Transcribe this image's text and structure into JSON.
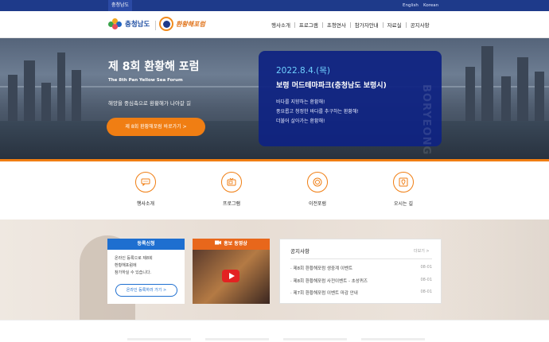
{
  "topbar": {
    "region": "충청남도",
    "lang_en": "English",
    "lang_ko": "Korean"
  },
  "header": {
    "logo1": "충청남도",
    "logo2": "환황해포럼",
    "nav": [
      "행사소개",
      "프로그램",
      "초청연사",
      "참가자안내",
      "자료실",
      "공지사항"
    ]
  },
  "hero": {
    "title": "제 8회 환황해 포럼",
    "subtitle": "The 8th Pan Yellow Sea Forum",
    "tagline": "해양을 중심축으로 환황해가 나아갈 길",
    "cta": "제 8회 환황해포럼 바로가기",
    "panel": {
      "date": "2022.8.4.(목)",
      "place": "보령 머드테마파크(충청남도 보령시)",
      "lines": [
        "바다를 지향하는 환황해!",
        "풍요롭고 청정한 바다를 추구하는 환황해!",
        "더불어 살아가는 환황해!"
      ],
      "vertical": "BORYEONG"
    }
  },
  "icon_menu": [
    {
      "label": "행사소개",
      "icon": "chat-icon"
    },
    {
      "label": "프로그램",
      "icon": "tv-icon"
    },
    {
      "label": "이전포럼",
      "icon": "target-icon"
    },
    {
      "label": "오시는 길",
      "icon": "location-icon"
    }
  ],
  "register": {
    "title": "등록신청",
    "lines": [
      "온라인 등록으로 제8회",
      "환황해포럼에",
      "참가하실 수 있습니다."
    ],
    "button": "온라인 등록하러 가기"
  },
  "video": {
    "title": "홍보 동영상"
  },
  "notice": {
    "title": "공지사항",
    "more": "더보기",
    "items": [
      {
        "title": "제8회 환황해포럼 생중계 이벤트",
        "date": "08-01"
      },
      {
        "title": "제8회 환황해포럼 사전이벤트 - 초성퀴즈",
        "date": "08-01"
      },
      {
        "title": "제7회 환황해포럼 이벤트 마감 안내",
        "date": "08-01"
      }
    ]
  },
  "colors": {
    "navy": "#1e3a8a",
    "orange": "#f07e13",
    "blue": "#1e6fd0",
    "cyan": "#6fd0ff"
  }
}
